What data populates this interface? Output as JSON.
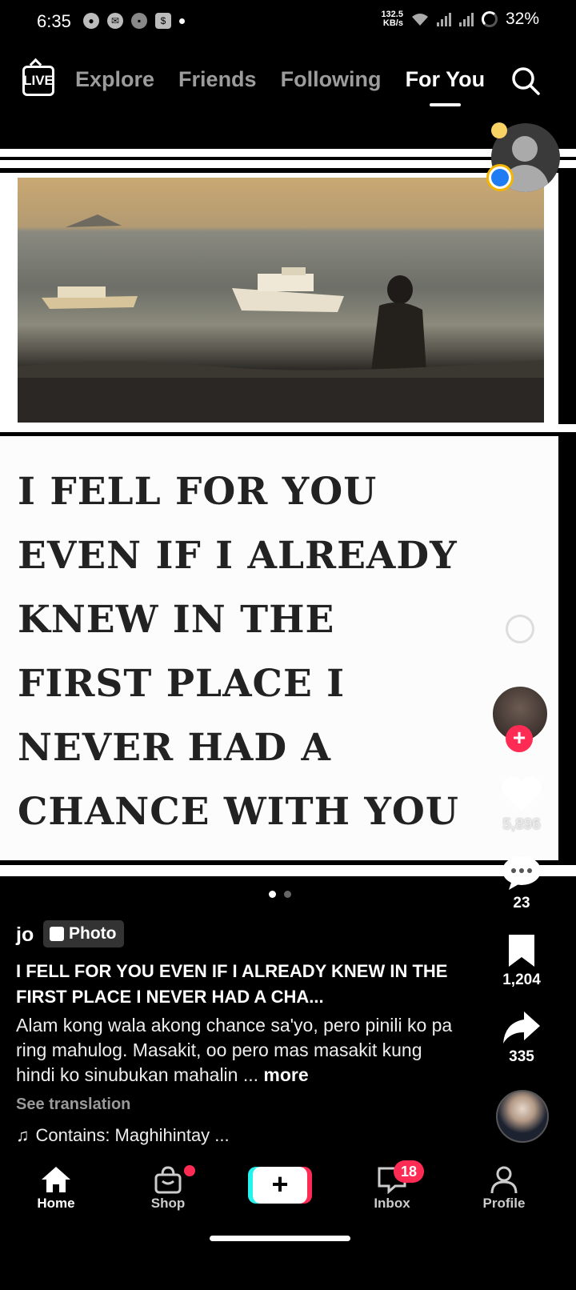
{
  "status_bar": {
    "time": "6:35",
    "net_speed_value": "132.5",
    "net_speed_unit": "KB/s",
    "battery": "32%"
  },
  "top_nav": {
    "live_label": "LIVE",
    "tabs": [
      {
        "label": "Explore"
      },
      {
        "label": "Friends"
      },
      {
        "label": "Following"
      },
      {
        "label": "For You",
        "active": true
      }
    ]
  },
  "post": {
    "quote_text": "I FELL FOR YOU EVEN IF I ALREADY KNEW IN THE FIRST PLACE I NEVER HAD A CHANCE WITH YOU",
    "likes": "5,896",
    "comments": "23",
    "saves": "1,204",
    "shares": "335",
    "username": "jo",
    "badge_label": "Photo",
    "title": "I FELL FOR YOU EVEN IF I ALREADY KNEW IN THE FIRST PLACE I NEVER HAD A CHA...",
    "description": "Alam kong wala akong chance sa'yo, pero pinili ko pa ring mahulog. Masakit, oo pero mas masakit kung hindi ko sinubukan mahalin ...",
    "more_label": "more",
    "see_translation": "See translation",
    "music": "Contains: Maghihintay ...",
    "photo_count": 2,
    "photo_index": 1
  },
  "bottom_nav": {
    "home": "Home",
    "shop": "Shop",
    "inbox": "Inbox",
    "inbox_badge": "18",
    "profile": "Profile"
  },
  "colors": {
    "accent_red": "#fe2c55",
    "accent_cyan": "#25f4ee"
  }
}
